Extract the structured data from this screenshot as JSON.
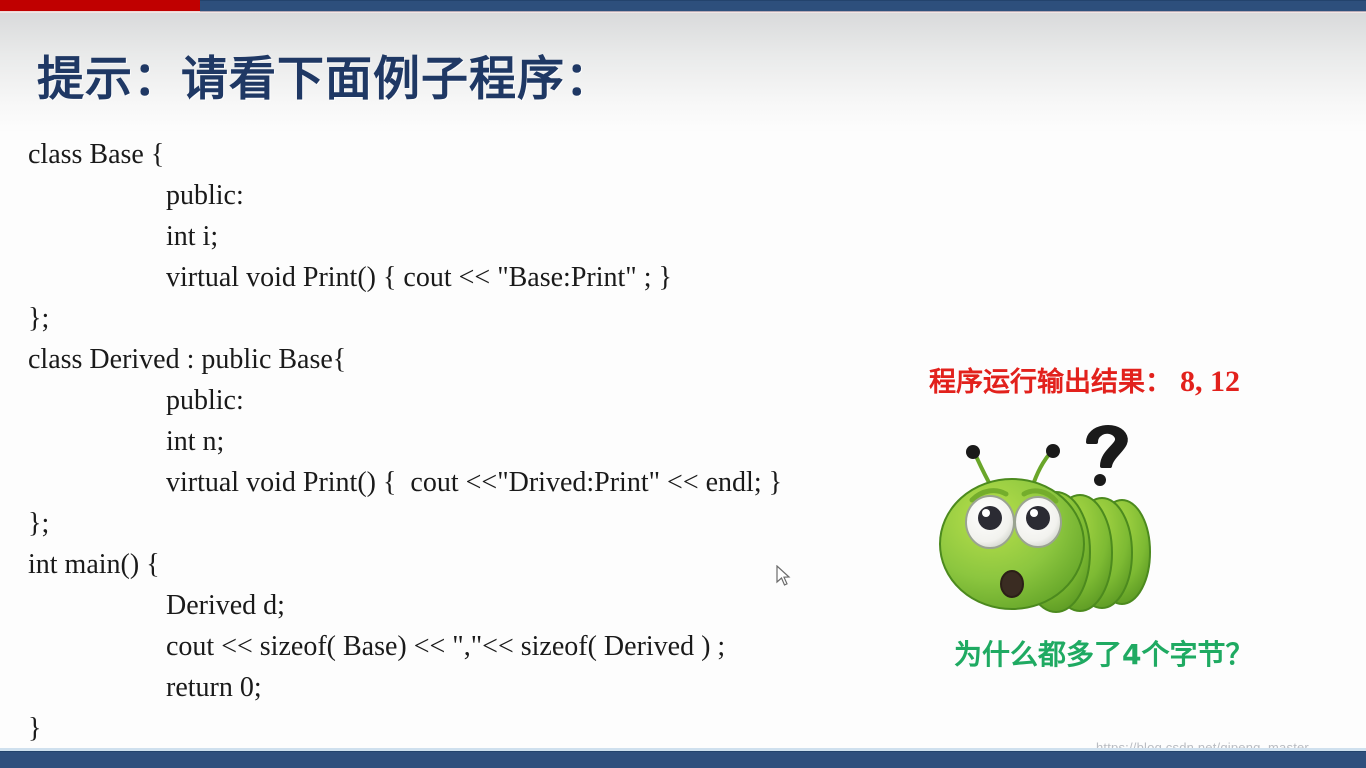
{
  "slide": {
    "title": "提示：请看下面例子程序：",
    "accent_red": "#c00000",
    "accent_blue": "#2d4f7c",
    "title_color": "#1f3864"
  },
  "code": {
    "language": "cpp",
    "lines": [
      {
        "text": "class Base {",
        "indent": false
      },
      {
        "text": "public:",
        "indent": true
      },
      {
        "text": "int i;",
        "indent": true
      },
      {
        "text": "virtual void Print() { cout << \"Base:Print\" ; }",
        "indent": true
      },
      {
        "text": "};",
        "indent": false
      },
      {
        "text": "class Derived : public Base{",
        "indent": false
      },
      {
        "text": "public:",
        "indent": true
      },
      {
        "text": "int n;",
        "indent": true
      },
      {
        "text": "virtual void Print() {  cout <<\"Drived:Print\" << endl; }",
        "indent": true
      },
      {
        "text": "};",
        "indent": false
      },
      {
        "text": "int main() {",
        "indent": false
      },
      {
        "text": "Derived d;",
        "indent": true
      },
      {
        "text": "cout << sizeof( Base) << \",\"<< sizeof( Derived ) ;",
        "indent": true
      },
      {
        "text": "return 0;",
        "indent": true
      },
      {
        "text": "}",
        "indent": false
      }
    ]
  },
  "annotations": {
    "result_label": "程序运行输出结果：",
    "result_value": "8, 12",
    "result_color": "#e2211c",
    "question_text": "为什么都多了4个字节？",
    "question_color": "#1faa62"
  },
  "mascot": {
    "name": "green-caterpillar-confused",
    "body_color": "#8cc63f",
    "question_mark": "?"
  },
  "watermark": {
    "text": "https://blog.csdn.net/qipeng_master"
  }
}
